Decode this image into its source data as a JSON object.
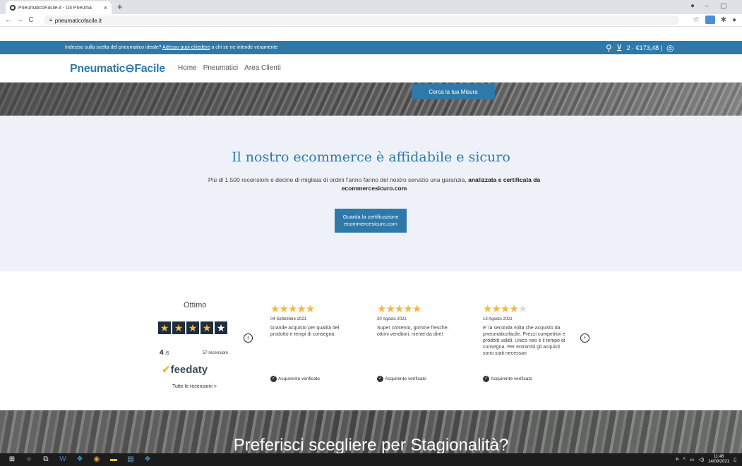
{
  "browser": {
    "tab_title": "PneumaticoFacile.it - Gli Pneuma",
    "tab_close": "×",
    "new_tab": "+",
    "url": "pneumaticofacile.it",
    "minimize": "–",
    "restore": "▢"
  },
  "announce": {
    "text_before": "Indeciso sulla scelta del pneumatico ideale?",
    "link": "Adesso puoi chiedere",
    "text_after": "a chi se ne intende veramente",
    "cart": "2 · €173,48 |"
  },
  "header": {
    "logo_part1": "Pneumatic",
    "logo_part2": "Facile",
    "nav": [
      "Home",
      "Pneumatici",
      "Area Clienti"
    ]
  },
  "hero": {
    "search_button": "Cerca la tua Misura"
  },
  "trust": {
    "title": "Il nostro ecommerce è affidabile e sicuro",
    "text": "Più di 1.500 recensioni e decine di migliaia di ordini l'anno fanno del nostro servizio una garanzia,",
    "text_bold": "analizzata e certificata da ecommercesicuro.com",
    "cert_button": "Guarda la certificazione ecommercesicuro.com"
  },
  "reviews": {
    "rating_label": "Ottimo",
    "score": "4",
    "score_max": "/5",
    "count": "57 recensioni",
    "brand": "feedaty",
    "all_link": "Tutte le recensioni >",
    "prev": "‹",
    "next": "›",
    "items": [
      {
        "stars": 5,
        "date": "04 Settembre 2021",
        "text": "Grande acquisto per qualità del prodotto e tempi di consegna.",
        "verified": "Acquirente verificato"
      },
      {
        "stars": 5,
        "date": "20 Agosto 2021",
        "text": "Super contento, gomme fresche, ottimi venditori, niente da dire!",
        "verified": "Acquirente verificato"
      },
      {
        "stars": 4,
        "date": "13 Agosto 2021",
        "text": "E' la seconda volta che acquisto da pneumaticofacile. Prezzi competitivi e prodotti validi. Unico neo è il tempo di consegna. Per entrambi gli acquisti sono stati necessari",
        "verified": "Acquirente verificato"
      }
    ]
  },
  "seasonal": {
    "title": "Preferisci scegliere per Stagionalità?"
  },
  "taskbar": {
    "time": "11:46",
    "date": "14/09/2021"
  },
  "colors": {
    "brand_blue": "#2f79a9",
    "star_gold": "#f5b940",
    "trust_bg": "#eef2f8"
  }
}
